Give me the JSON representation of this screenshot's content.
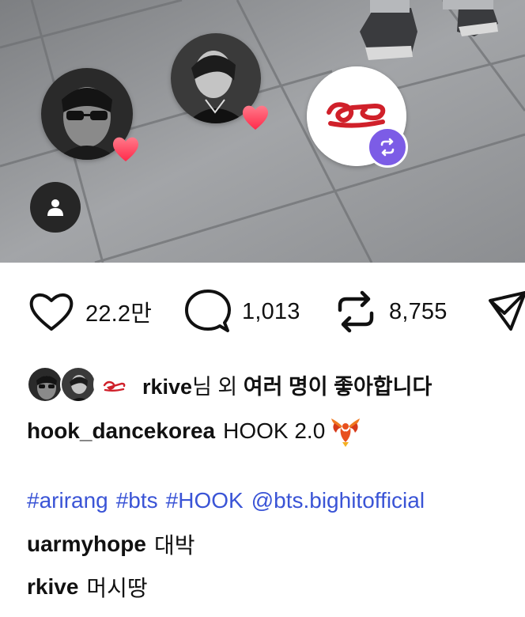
{
  "photo": {
    "tagged_users": [
      "person-avatar-1",
      "person-avatar-2",
      "brand-logo-avatar"
    ]
  },
  "actions": {
    "likes": "22.2만",
    "comments": "1,013",
    "reposts": "8,755"
  },
  "liked_by": {
    "user": "rkive",
    "suffix_plain": "님 외 ",
    "suffix_bold": "여러 명이 좋아합니다"
  },
  "caption": {
    "user": "hook_dancekorea",
    "text": "HOOK 2.0"
  },
  "hashtags": [
    "#arirang",
    "#bts",
    "#HOOK",
    "@bts.bighitofficial"
  ],
  "comments": [
    {
      "user": "uarmyhope",
      "text": "대박"
    },
    {
      "user": "rkive",
      "text": "머시땅"
    }
  ],
  "colors": {
    "link": "#3a54d6",
    "repost_badge": "#7c5ce6",
    "heart": "#ff3b5c",
    "logo_red": "#d0202a"
  }
}
